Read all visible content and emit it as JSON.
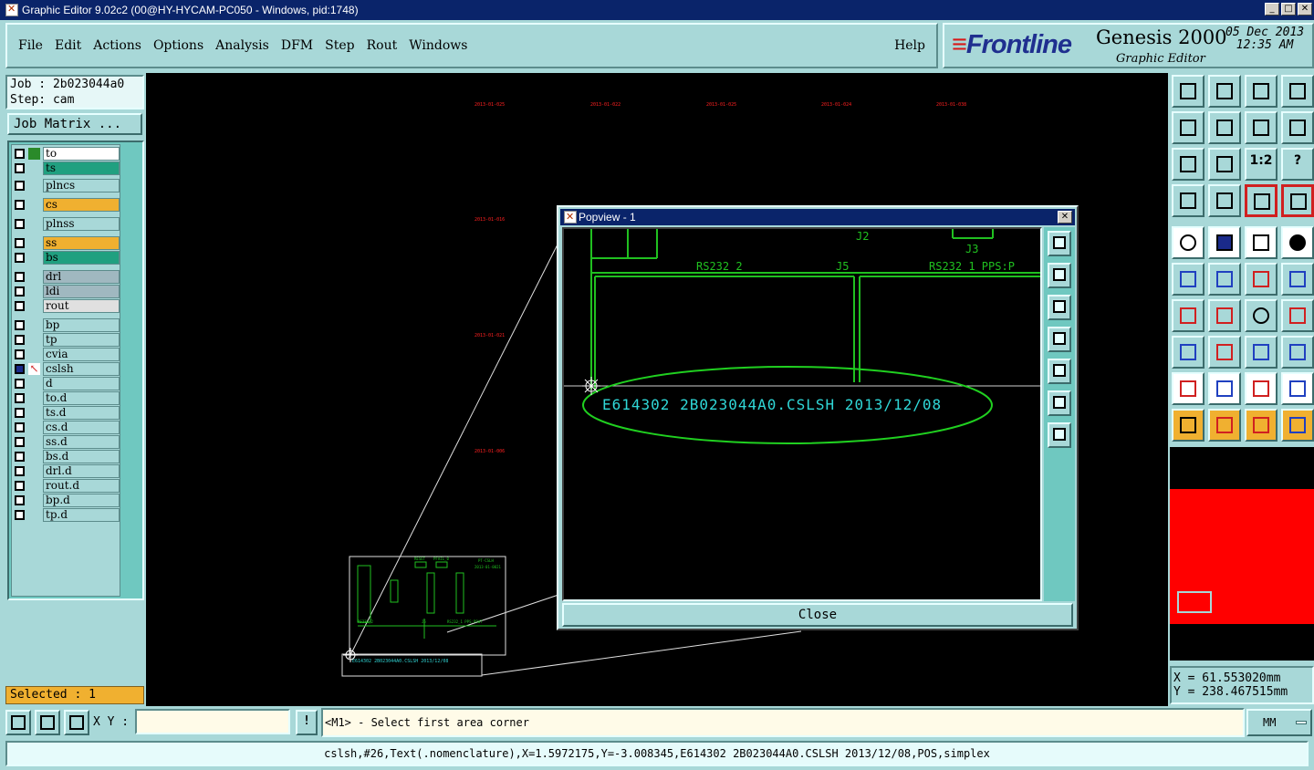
{
  "window": {
    "title": "Graphic Editor 9.02c2 (00@HY-HYCAM-PC050 - Windows, pid:1748)",
    "btn_min": "_",
    "btn_max": "□",
    "btn_close": "✕"
  },
  "menu": {
    "file": "File",
    "edit": "Edit",
    "actions": "Actions",
    "options": "Options",
    "analysis": "Analysis",
    "dfm": "DFM",
    "step": "Step",
    "rout": "Rout",
    "windows": "Windows",
    "help": "Help"
  },
  "brand": {
    "logo": "Frontline",
    "product": "Genesis 2000",
    "subtitle": "Graphic Editor",
    "date": "05 Dec 2013",
    "time": "12:35 AM"
  },
  "job": {
    "job_line": "Job : 2b023044a0",
    "step_line": "Step: cam",
    "matrix_button": "Job Matrix ..."
  },
  "layers": [
    {
      "name": "to",
      "color": "#ffffff",
      "swatch": "#2a8a2a"
    },
    {
      "name": "ts",
      "color": "#20a080",
      "swatch": ""
    },
    {
      "name": "plncs",
      "color": "#a8d8d8",
      "swatch": ""
    },
    {
      "name": "cs",
      "color": "#f0b030",
      "swatch": ""
    },
    {
      "name": "plnss",
      "color": "#a8d8d8",
      "swatch": ""
    },
    {
      "name": "ss",
      "color": "#f0b030",
      "swatch": ""
    },
    {
      "name": "bs",
      "color": "#20a080",
      "swatch": ""
    },
    {
      "name": "drl",
      "color": "#a0b8c0",
      "swatch": ""
    },
    {
      "name": "ldi",
      "color": "#a0b8c0",
      "swatch": ""
    },
    {
      "name": "rout",
      "color": "#e0e0e0",
      "swatch": ""
    },
    {
      "name": "bp",
      "color": "#a8d8d8",
      "swatch": ""
    },
    {
      "name": "tp",
      "color": "#a8d8d8",
      "swatch": ""
    },
    {
      "name": "cvia",
      "color": "#a8d8d8",
      "swatch": ""
    },
    {
      "name": "cslsh",
      "color": "#a8d8d8",
      "swatch": "",
      "active": true
    },
    {
      "name": "d",
      "color": "#a8d8d8",
      "swatch": ""
    },
    {
      "name": "to.d",
      "color": "#a8d8d8",
      "swatch": ""
    },
    {
      "name": "ts.d",
      "color": "#a8d8d8",
      "swatch": ""
    },
    {
      "name": "cs.d",
      "color": "#a8d8d8",
      "swatch": ""
    },
    {
      "name": "ss.d",
      "color": "#a8d8d8",
      "swatch": ""
    },
    {
      "name": "bs.d",
      "color": "#a8d8d8",
      "swatch": ""
    },
    {
      "name": "drl.d",
      "color": "#a8d8d8",
      "swatch": ""
    },
    {
      "name": "rout.d",
      "color": "#a8d8d8",
      "swatch": ""
    },
    {
      "name": "bp.d",
      "color": "#a8d8d8",
      "swatch": ""
    },
    {
      "name": "tp.d",
      "color": "#a8d8d8",
      "swatch": ""
    }
  ],
  "selected": "Selected : 1",
  "canvas": {
    "date_labels": [
      "2013-01-025",
      "2013-01-022",
      "2013-01-025",
      "2013-01-024",
      "2013-01-038"
    ],
    "side_labels": [
      "2013-01-016",
      "2013-01-021",
      "2013-01-006"
    ],
    "thumb_text": "E614302 2B023044A0.CSLSH 2013/12/08",
    "thumb_labels": [
      "RESET",
      "PFAIL_0",
      "PT-CSLH",
      "2013-01-0021",
      "RS232_2",
      "J5",
      "RS232_1 PPS:POWT"
    ]
  },
  "popview": {
    "title": "Popview - 1",
    "close_label": "Close",
    "labels": {
      "j2": "J2",
      "j3": "J3",
      "rs232_2": "RS232_2",
      "j5": "J5",
      "rs232_1": "RS232_1 PPS:P",
      "nameplate": "E614302  2B023044A0.CSLSH 2013/12/08"
    }
  },
  "tools": {
    "ratio_label": "1:2",
    "help_label": "?"
  },
  "coords": {
    "x": "X =  61.553020mm",
    "y": "Y = 238.467515mm"
  },
  "cmd": {
    "xy_label": "X Y :",
    "xy_value": "",
    "excl": "!",
    "prompt": "<M1> - Select first area corner",
    "units": "MM"
  },
  "status": "cslsh,#26,Text(.nomenclature),X=1.5972175,Y=-3.008345,E614302 2B023044A0.CSLSH 2013/12/08,POS,simplex"
}
